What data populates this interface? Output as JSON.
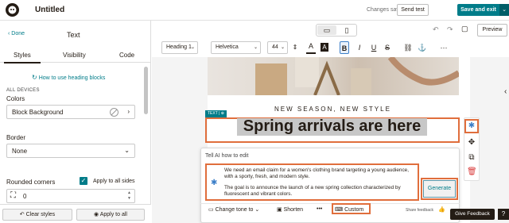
{
  "topbar": {
    "title": "Untitled",
    "status": "Changes saved",
    "send_test": "Send test",
    "save_exit": "Save and exit",
    "save_caret": "⌄"
  },
  "left_panel": {
    "done": "‹ Done",
    "title": "Text",
    "tabs": [
      {
        "label": "Styles"
      },
      {
        "label": "Visibility"
      },
      {
        "label": "Code"
      }
    ],
    "help_link": "How to use heading blocks",
    "all_devices": "ALL DEVICES",
    "colors_label": "Colors",
    "block_bg": "Block Background",
    "border_label": "Border",
    "border_value": "None",
    "rounded_label": "Rounded corners",
    "apply_all_sides": "Apply to all sides",
    "corner_value": "0",
    "clear_styles": "Clear styles",
    "apply_to_all": "Apply to all"
  },
  "view": {
    "preview": "Preview"
  },
  "toolbar": {
    "block_style": "Heading 1",
    "font": "Helvetica",
    "size": "44"
  },
  "canvas": {
    "season_line": "NEW SEASON, NEW STYLE",
    "text_tag": "TEXT | ⊕",
    "heading": "Spring arrivals are here"
  },
  "ai": {
    "title": "Tell AI how to edit",
    "prompt_line1": "We need an email claim for a women's clothing brand targeting a young audience, with a sporty, fresh, and modern style.",
    "prompt_line2": "The goal is to announce the launch of a new spring collection characterized by fluorescent and vibrant colors.",
    "generate": "Generate",
    "change_tone": "Change tone to",
    "shorten": "Shorten",
    "more": "•••",
    "custom": "Custom",
    "share_feedback": "Share feedback"
  },
  "give_feedback": "Give Feedback",
  "help": "?",
  "colors": {
    "accent": "#007c89",
    "highlight": "#e06e3c",
    "dark": "#241c15"
  }
}
